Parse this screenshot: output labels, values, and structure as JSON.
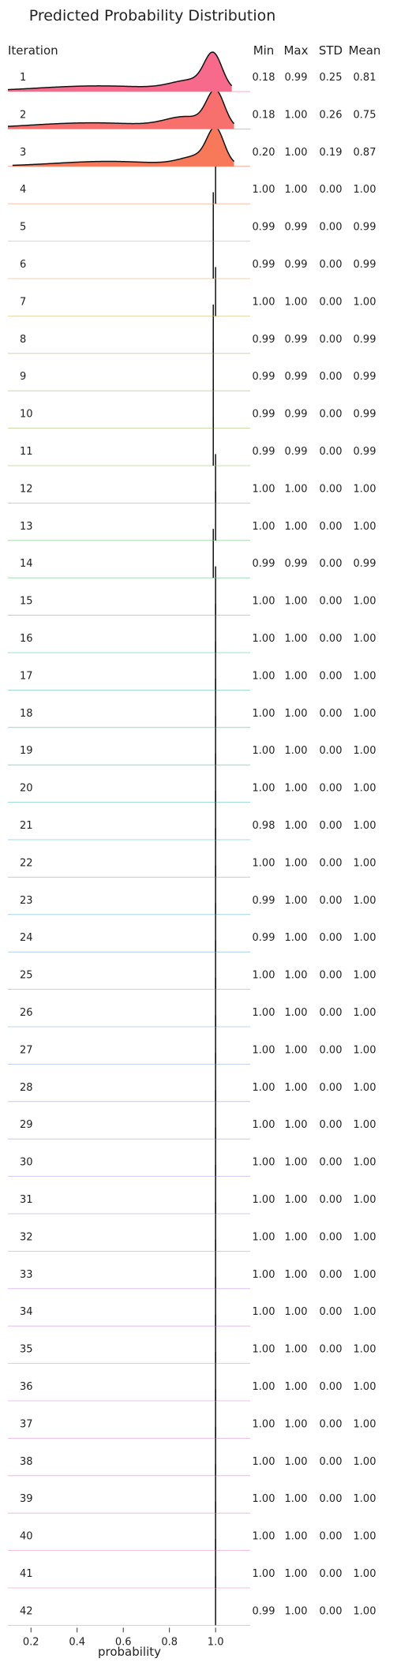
{
  "chart_data": {
    "type": "area",
    "title": "Predicted Probability Distribution",
    "xlabel": "probability",
    "row_header": "Iteration",
    "xlim": [
      0.1,
      1.15
    ],
    "x_ticks": [
      0.2,
      0.4,
      0.6,
      0.8,
      1.0
    ],
    "x_tick_labels": [
      "0.2",
      "0.4",
      "0.6",
      "0.8",
      "1.0"
    ],
    "stat_headers": [
      "Min",
      "Max",
      "STD",
      "Mean"
    ],
    "rows": [
      {
        "iteration": "1",
        "min": "0.18",
        "max": "0.99",
        "std": "0.25",
        "mean": "0.81",
        "color": "#f76a8c"
      },
      {
        "iteration": "2",
        "min": "0.18",
        "max": "1.00",
        "std": "0.26",
        "mean": "0.75",
        "color": "#f7706e"
      },
      {
        "iteration": "3",
        "min": "0.20",
        "max": "1.00",
        "std": "0.19",
        "mean": "0.87",
        "color": "#f8785a"
      },
      {
        "iteration": "4",
        "min": "1.00",
        "max": "1.00",
        "std": "0.00",
        "mean": "1.00",
        "color": "#f3a07e"
      },
      {
        "iteration": "5",
        "min": "0.99",
        "max": "0.99",
        "std": "0.00",
        "mean": "0.99",
        "color": "#e8ac77"
      },
      {
        "iteration": "6",
        "min": "0.99",
        "max": "0.99",
        "std": "0.00",
        "mean": "0.99",
        "color": "#dcb36f"
      },
      {
        "iteration": "7",
        "min": "1.00",
        "max": "1.00",
        "std": "0.00",
        "mean": "1.00",
        "color": "#cfb86b"
      },
      {
        "iteration": "8",
        "min": "0.99",
        "max": "0.99",
        "std": "0.00",
        "mean": "0.99",
        "color": "#c2bc6a"
      },
      {
        "iteration": "9",
        "min": "0.99",
        "max": "0.99",
        "std": "0.00",
        "mean": "0.99",
        "color": "#b4bf6b"
      },
      {
        "iteration": "10",
        "min": "0.99",
        "max": "0.99",
        "std": "0.00",
        "mean": "0.99",
        "color": "#a6c26e"
      },
      {
        "iteration": "11",
        "min": "0.99",
        "max": "0.99",
        "std": "0.00",
        "mean": "0.99",
        "color": "#98c473"
      },
      {
        "iteration": "12",
        "min": "1.00",
        "max": "1.00",
        "std": "0.00",
        "mean": "1.00",
        "color": "#8ac57a"
      },
      {
        "iteration": "13",
        "min": "1.00",
        "max": "1.00",
        "std": "0.00",
        "mean": "1.00",
        "color": "#7dc682"
      },
      {
        "iteration": "14",
        "min": "0.99",
        "max": "0.99",
        "std": "0.00",
        "mean": "0.99",
        "color": "#71c78b"
      },
      {
        "iteration": "15",
        "min": "1.00",
        "max": "1.00",
        "std": "0.00",
        "mean": "1.00",
        "color": "#66c794"
      },
      {
        "iteration": "16",
        "min": "1.00",
        "max": "1.00",
        "std": "0.00",
        "mean": "1.00",
        "color": "#5ec79e"
      },
      {
        "iteration": "17",
        "min": "1.00",
        "max": "1.00",
        "std": "0.00",
        "mean": "1.00",
        "color": "#59c6a8"
      },
      {
        "iteration": "18",
        "min": "1.00",
        "max": "1.00",
        "std": "0.00",
        "mean": "1.00",
        "color": "#58c5b1"
      },
      {
        "iteration": "19",
        "min": "1.00",
        "max": "1.00",
        "std": "0.00",
        "mean": "1.00",
        "color": "#5ac4ba"
      },
      {
        "iteration": "20",
        "min": "1.00",
        "max": "1.00",
        "std": "0.00",
        "mean": "1.00",
        "color": "#5ec2c2"
      },
      {
        "iteration": "21",
        "min": "0.98",
        "max": "1.00",
        "std": "0.00",
        "mean": "1.00",
        "color": "#63c0ca"
      },
      {
        "iteration": "22",
        "min": "1.00",
        "max": "1.00",
        "std": "0.00",
        "mean": "1.00",
        "color": "#6abed1"
      },
      {
        "iteration": "23",
        "min": "0.99",
        "max": "1.00",
        "std": "0.00",
        "mean": "1.00",
        "color": "#71bbd8"
      },
      {
        "iteration": "24",
        "min": "0.99",
        "max": "1.00",
        "std": "0.00",
        "mean": "1.00",
        "color": "#79b9de"
      },
      {
        "iteration": "25",
        "min": "1.00",
        "max": "1.00",
        "std": "0.00",
        "mean": "1.00",
        "color": "#81b6e3"
      },
      {
        "iteration": "26",
        "min": "1.00",
        "max": "1.00",
        "std": "0.00",
        "mean": "1.00",
        "color": "#8ab3e7"
      },
      {
        "iteration": "27",
        "min": "1.00",
        "max": "1.00",
        "std": "0.00",
        "mean": "1.00",
        "color": "#93b0ea"
      },
      {
        "iteration": "28",
        "min": "1.00",
        "max": "1.00",
        "std": "0.00",
        "mean": "1.00",
        "color": "#9cadec"
      },
      {
        "iteration": "29",
        "min": "1.00",
        "max": "1.00",
        "std": "0.00",
        "mean": "1.00",
        "color": "#a5aaee"
      },
      {
        "iteration": "30",
        "min": "1.00",
        "max": "1.00",
        "std": "0.00",
        "mean": "1.00",
        "color": "#aea7ee"
      },
      {
        "iteration": "31",
        "min": "1.00",
        "max": "1.00",
        "std": "0.00",
        "mean": "1.00",
        "color": "#b7a4ee"
      },
      {
        "iteration": "32",
        "min": "1.00",
        "max": "1.00",
        "std": "0.00",
        "mean": "1.00",
        "color": "#c0a1ed"
      },
      {
        "iteration": "33",
        "min": "1.00",
        "max": "1.00",
        "std": "0.00",
        "mean": "1.00",
        "color": "#c89eeb"
      },
      {
        "iteration": "34",
        "min": "1.00",
        "max": "1.00",
        "std": "0.00",
        "mean": "1.00",
        "color": "#d09be8"
      },
      {
        "iteration": "35",
        "min": "1.00",
        "max": "1.00",
        "std": "0.00",
        "mean": "1.00",
        "color": "#d898e4"
      },
      {
        "iteration": "36",
        "min": "1.00",
        "max": "1.00",
        "std": "0.00",
        "mean": "1.00",
        "color": "#df95df"
      },
      {
        "iteration": "37",
        "min": "1.00",
        "max": "1.00",
        "std": "0.00",
        "mean": "1.00",
        "color": "#e593d9"
      },
      {
        "iteration": "38",
        "min": "1.00",
        "max": "1.00",
        "std": "0.00",
        "mean": "1.00",
        "color": "#ea91d2"
      },
      {
        "iteration": "39",
        "min": "1.00",
        "max": "1.00",
        "std": "0.00",
        "mean": "1.00",
        "color": "#ef8fca"
      },
      {
        "iteration": "40",
        "min": "1.00",
        "max": "1.00",
        "std": "0.00",
        "mean": "1.00",
        "color": "#f28ec2"
      },
      {
        "iteration": "41",
        "min": "1.00",
        "max": "1.00",
        "std": "0.00",
        "mean": "1.00",
        "color": "#f58db9"
      },
      {
        "iteration": "42",
        "min": "0.99",
        "max": "1.00",
        "std": "0.00",
        "mean": "1.00",
        "color": "#f78cb0"
      }
    ]
  }
}
